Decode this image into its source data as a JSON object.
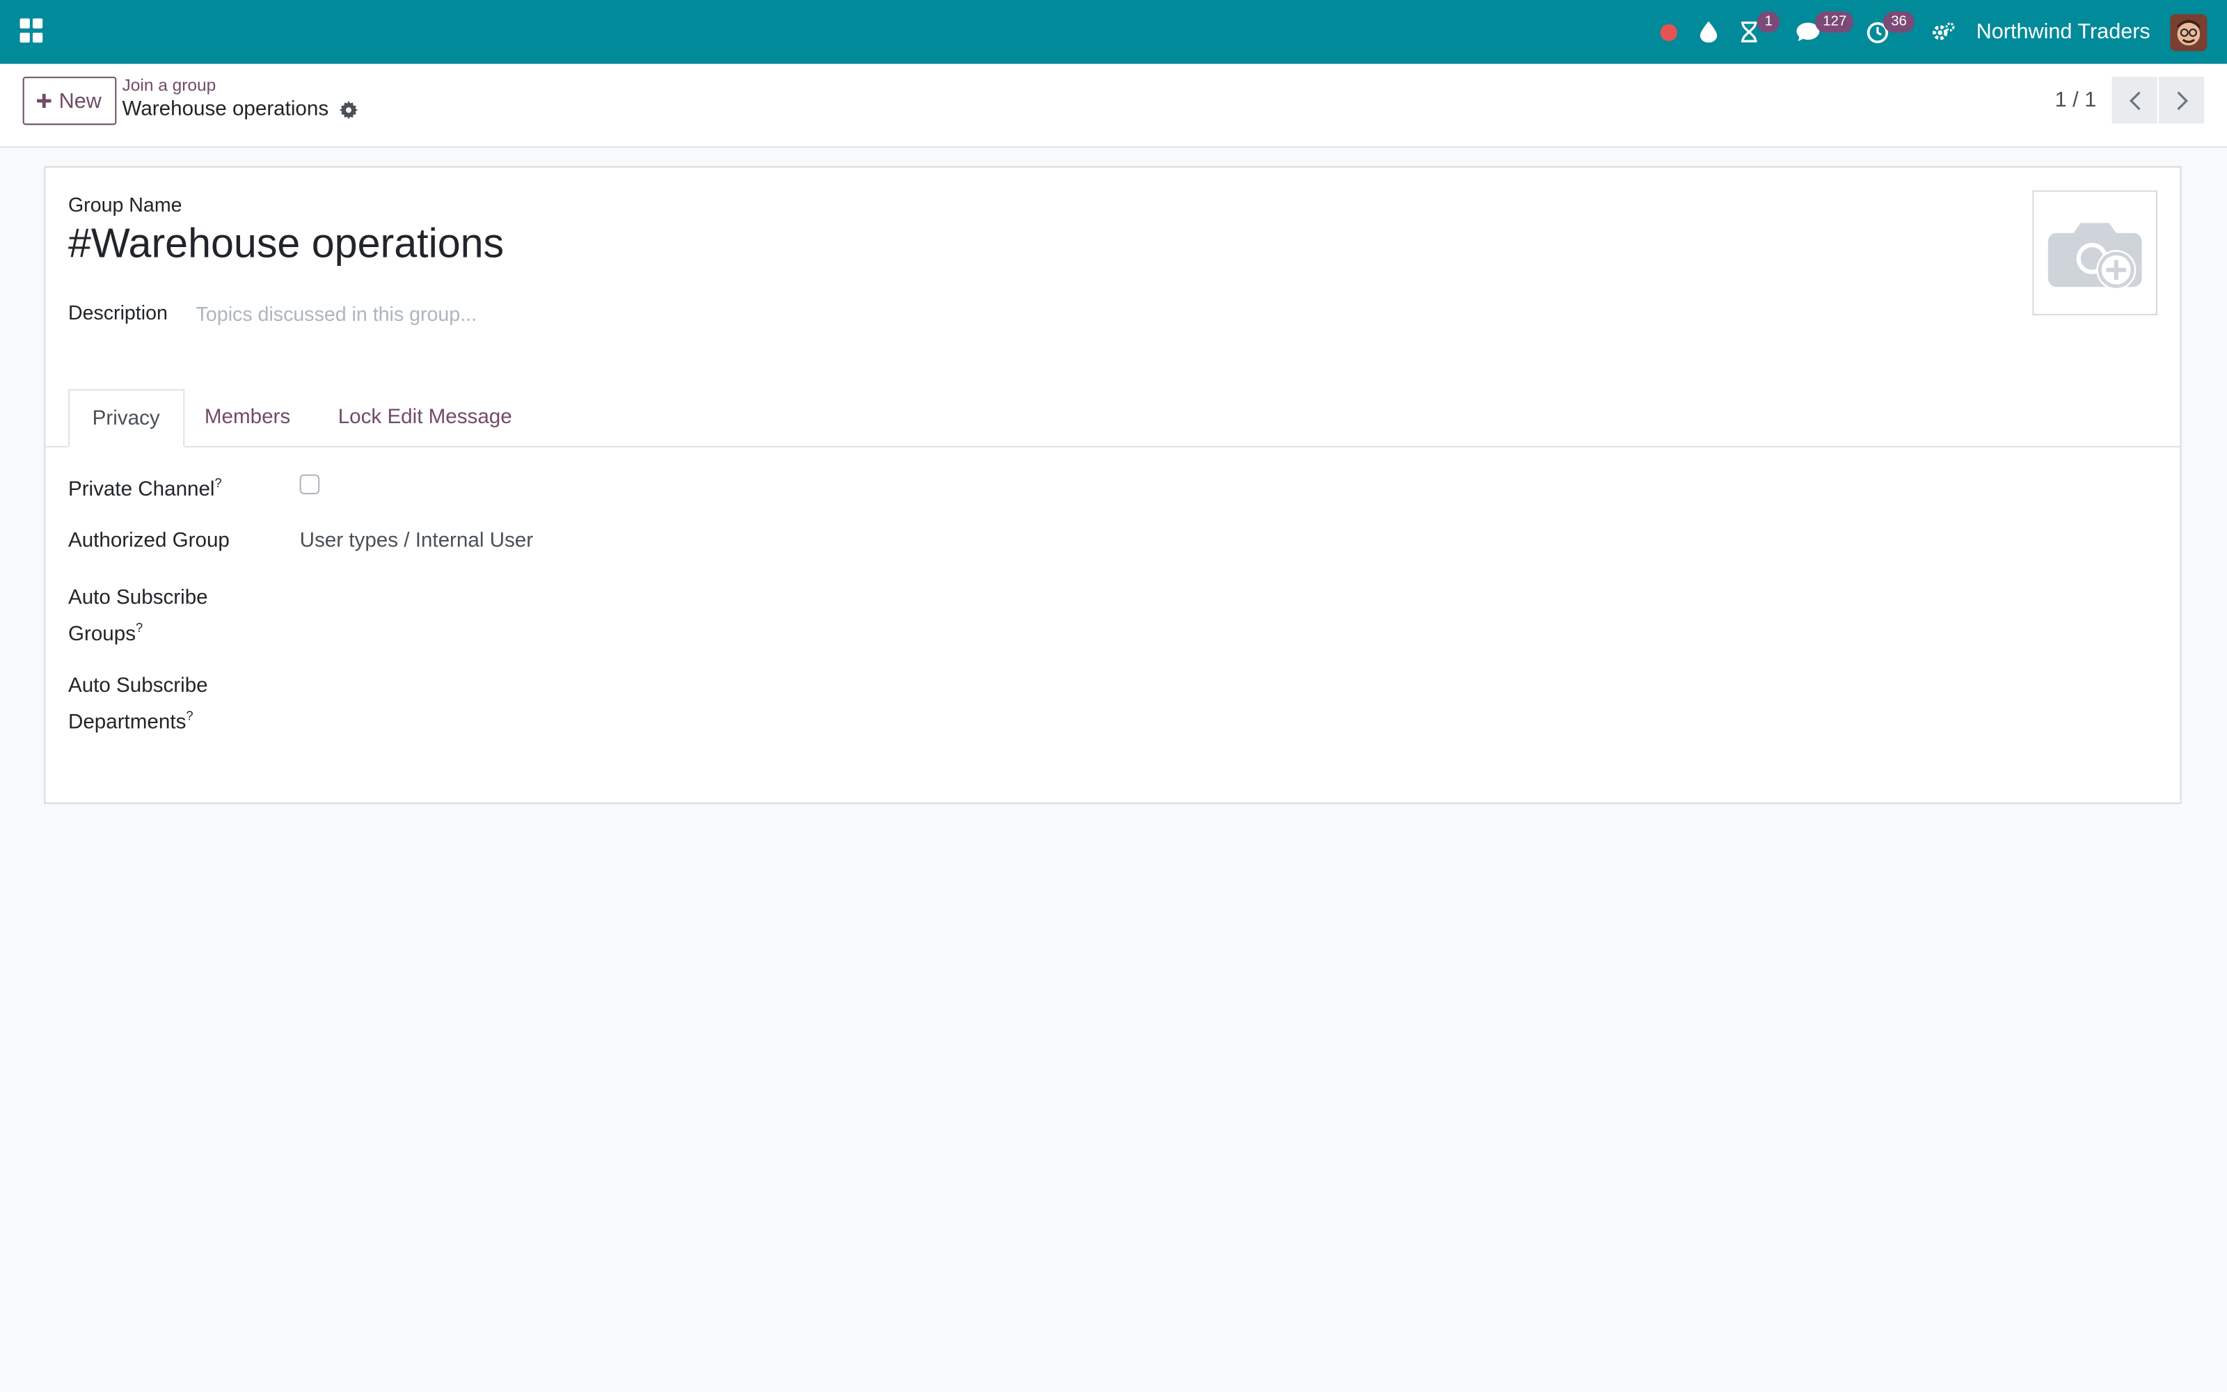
{
  "navbar": {
    "company": "Northwind Traders",
    "badges": {
      "activities": "1",
      "messages": "127",
      "clock": "36"
    },
    "colors": {
      "bar": "#018a9a",
      "record_dot": "#e55353",
      "badge": "#7b4a76"
    }
  },
  "control_panel": {
    "new_label": "New",
    "breadcrumb_parent": "Join a group",
    "record_title": "Warehouse operations",
    "pager": "1 / 1"
  },
  "form": {
    "group_name_label": "Group Name",
    "group_name": "#Warehouse operations",
    "description_label": "Description",
    "description_placeholder": "Topics discussed in this group...",
    "tabs": [
      {
        "label": "Privacy"
      },
      {
        "label": "Members"
      },
      {
        "label": "Lock Edit Message"
      }
    ],
    "privacy": {
      "private_channel_label": "Private Channel",
      "authorized_group_label": "Authorized Group",
      "authorized_group_value": "User types / Internal User",
      "auto_subscribe_groups_line1": "Auto Subscribe",
      "auto_subscribe_groups_line2": "Groups",
      "auto_subscribe_departments_line1": "Auto Subscribe",
      "auto_subscribe_departments_line2": "Departments",
      "help_mark": "?"
    }
  },
  "icons": [
    "apps-icon",
    "record-dot-icon",
    "drop-icon",
    "hourglass-icon",
    "chat-icon",
    "clock-icon",
    "settings-icon",
    "gear-icon",
    "camera-add-icon",
    "chevron-left-icon",
    "chevron-right-icon",
    "plus-icon"
  ]
}
